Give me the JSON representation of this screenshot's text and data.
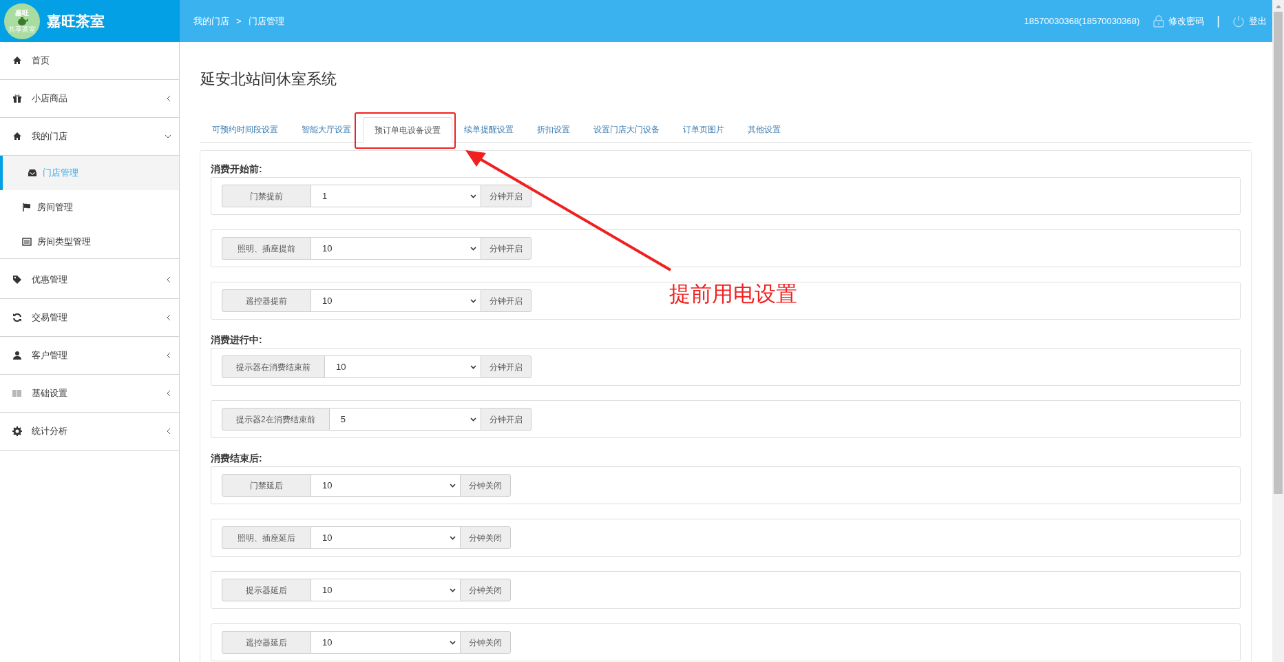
{
  "header": {
    "logo": {
      "line_1": "嘉旺",
      "line_2": "共享茶室"
    },
    "brand": "嘉旺茶室",
    "breadcrumb": [
      "我的门店",
      "门店管理"
    ],
    "breadcrumb_separator": ">",
    "user": "18570030368(18570030368)",
    "change_password": "修改密码",
    "divider": "|",
    "logout": "登出"
  },
  "sidebar": {
    "items": [
      {
        "label": "首页",
        "has_arrow": false
      },
      {
        "label": "小店商品",
        "expanded": false,
        "has_arrow": true
      },
      {
        "label": "我的门店",
        "expanded": true,
        "has_arrow": true,
        "children": [
          {
            "label": "门店管理",
            "selected": true
          },
          {
            "label": "房间管理",
            "selected": false
          },
          {
            "label": "房间类型管理",
            "selected": false
          }
        ]
      },
      {
        "label": "优惠管理",
        "expanded": false,
        "has_arrow": true
      },
      {
        "label": "交易管理",
        "expanded": false,
        "has_arrow": true
      },
      {
        "label": "客户管理",
        "expanded": false,
        "has_arrow": true
      },
      {
        "label": "基础设置",
        "expanded": false,
        "has_arrow": true
      },
      {
        "label": "统计分析",
        "expanded": false,
        "has_arrow": true
      }
    ]
  },
  "page_title": "延安北站间休室系统",
  "tabs": [
    {
      "label": "可预约时间段设置",
      "selected": false
    },
    {
      "label": "智能大厅设置",
      "selected": false
    },
    {
      "label": "预订单电设备设置",
      "selected": true
    },
    {
      "label": "续单提醒设置",
      "selected": false
    },
    {
      "label": "折扣设置",
      "selected": false
    },
    {
      "label": "设置门店大门设备",
      "selected": false
    },
    {
      "label": "订单页图片",
      "selected": false
    },
    {
      "label": "其他设置",
      "selected": false
    }
  ],
  "sections": [
    {
      "title": "消费开始前:",
      "rows": [
        {
          "label": "门禁提前",
          "value": "1",
          "unit": "分钟开启"
        },
        {
          "label": "照明、插座提前",
          "value": "10",
          "unit": "分钟开启"
        },
        {
          "label": "遥控器提前",
          "value": "10",
          "unit": "分钟开启"
        }
      ]
    },
    {
      "title": "消费进行中:",
      "rows": [
        {
          "label": "提示器在消费结束前",
          "value": "10",
          "unit": "分钟开启"
        },
        {
          "label": "提示器2在消费结束前",
          "value": "5",
          "unit": "分钟开启"
        }
      ]
    },
    {
      "title": "消费结束后:",
      "rows": [
        {
          "label": "门禁延后",
          "value": "10",
          "unit": "分钟关闭"
        },
        {
          "label": "照明、插座延后",
          "value": "10",
          "unit": "分钟关闭"
        },
        {
          "label": "提示器延后",
          "value": "10",
          "unit": "分钟关闭"
        },
        {
          "label": "遥控器延后",
          "value": "10",
          "unit": "分钟关闭"
        }
      ]
    }
  ],
  "annotation": {
    "text": "提前用电设置"
  }
}
